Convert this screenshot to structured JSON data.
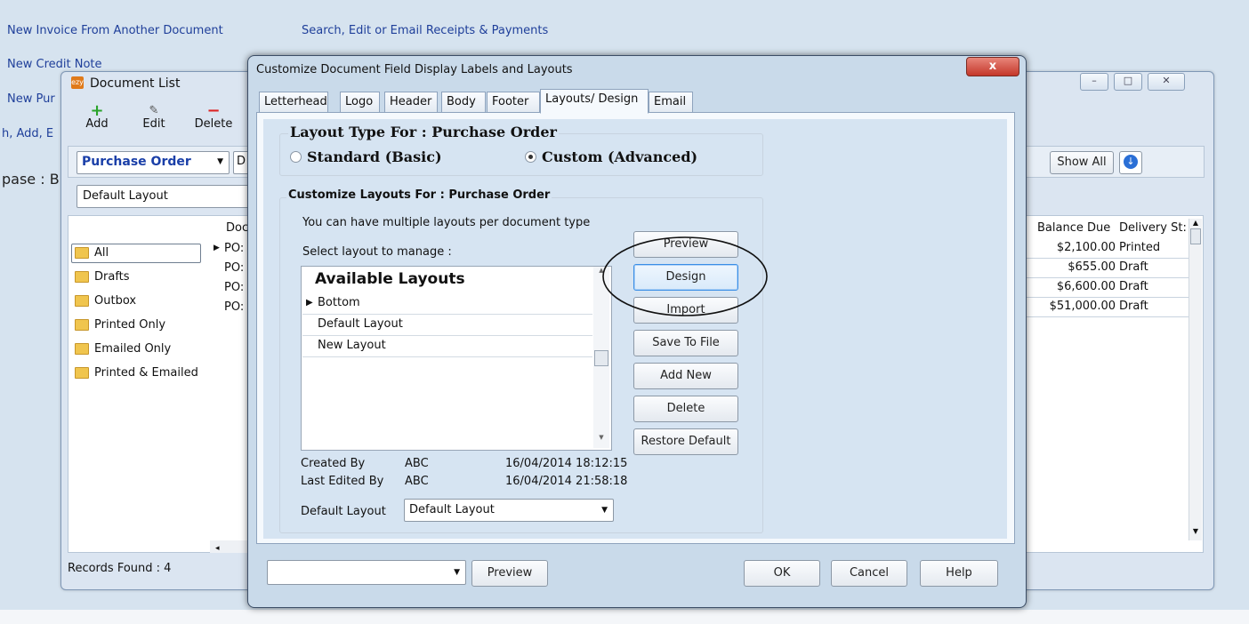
{
  "background": {
    "links": [
      "New Invoice From Another Document",
      "Search, Edit or Email Receipts & Payments",
      "New Credit Note",
      "New Pur",
      "h, Add, E",
      "pase : B"
    ]
  },
  "doclist": {
    "title": "Document List",
    "toolbar": {
      "add": "Add",
      "edit": "Edit",
      "delete": "Delete"
    },
    "doc_type": "Purchase Order",
    "d_label": "D",
    "layout_combo": "Default Layout",
    "show_all": "Show All",
    "folders": [
      "All",
      "Drafts",
      "Outbox",
      "Printed Only",
      "Emailed Only",
      "Printed & Emailed"
    ],
    "columns": {
      "doc": "Doc",
      "balance": "Balance Due",
      "delivery": "Delivery St:"
    },
    "rows": [
      {
        "doc": "PO:",
        "balance": "$2,100.00",
        "delivery": "Printed"
      },
      {
        "doc": "PO:",
        "balance": "$655.00",
        "delivery": "Draft"
      },
      {
        "doc": "PO:",
        "balance": "$6,600.00",
        "delivery": "Draft"
      },
      {
        "doc": "PO:",
        "balance": "$51,000.00",
        "delivery": "Draft"
      }
    ],
    "records_found": "Records Found : 4"
  },
  "dialog": {
    "title": "Customize Document Field Display Labels and Layouts",
    "close": "x",
    "tabs": [
      "Letterhead",
      "Logo",
      "Header",
      "Body",
      "Footer",
      "Layouts/ Design",
      "Email"
    ],
    "active_tab": "Layouts/ Design",
    "layout_type_title": "Layout Type For : Purchase Order",
    "radio_standard": "Standard (Basic)",
    "radio_custom": "Custom (Advanced)",
    "selected_radio": "Custom (Advanced)",
    "customize_title": "Customize Layouts For : Purchase Order",
    "info_text": "You can have multiple layouts per document type",
    "select_label": "Select layout to manage :",
    "list_header": "Available Layouts",
    "layouts": [
      "Bottom",
      "Default Layout",
      "New Layout"
    ],
    "selected_layout": "Bottom",
    "buttons": [
      "Preview",
      "Design",
      "Import",
      "Save To File",
      "Add New",
      "Delete",
      "Restore Default"
    ],
    "created_by_label": "Created By",
    "created_by_value": "ABC",
    "created_date": "16/04/2014 18:12:15",
    "edited_by_label": "Last Edited By",
    "edited_by_value": "ABC",
    "edited_date": "16/04/2014 21:58:18",
    "default_layout_label": "Default Layout",
    "default_layout_value": "Default Layout",
    "footer": {
      "combo_value": "",
      "preview": "Preview",
      "ok": "OK",
      "cancel": "Cancel",
      "help": "Help"
    }
  }
}
